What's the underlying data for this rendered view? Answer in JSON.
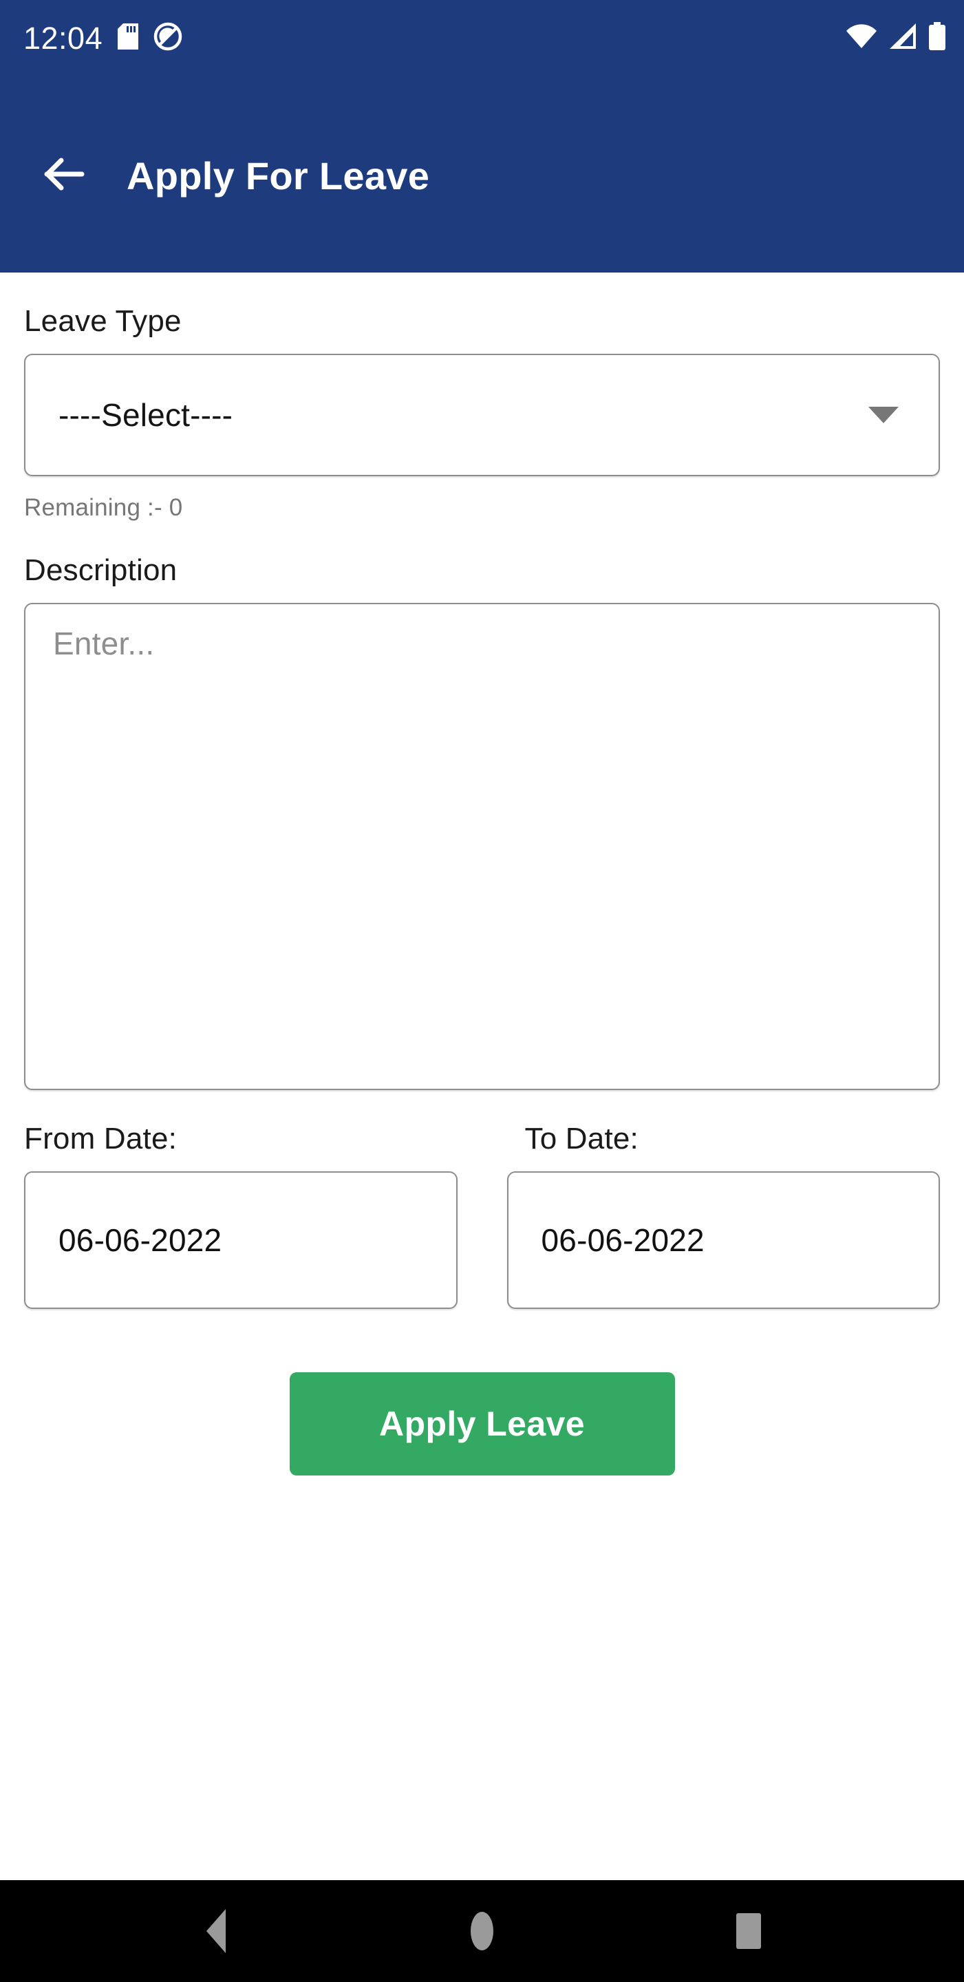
{
  "status_bar": {
    "time": "12:04",
    "left_icons": [
      "sd-card-icon",
      "do-not-disturb-icon"
    ],
    "right_icons": [
      "wifi-icon",
      "cellular-signal-icon",
      "battery-icon"
    ]
  },
  "app_bar": {
    "back_icon": "back-arrow-icon",
    "title": "Apply For Leave",
    "background_color": "#1e3b7d"
  },
  "form": {
    "leave_type": {
      "label": "Leave Type",
      "selected_value": "----Select----",
      "caret_icon": "chevron-down-icon",
      "helper_text": "Remaining :- 0"
    },
    "description": {
      "label": "Description",
      "value": "",
      "placeholder": "Enter..."
    },
    "from_date": {
      "label": "From Date:",
      "value": "06-06-2022"
    },
    "to_date": {
      "label": "To Date:",
      "value": "06-06-2022"
    },
    "submit": {
      "label": "Apply Leave",
      "color": "#33a963"
    }
  },
  "nav_bar": {
    "back_label": "back-triangle-icon",
    "home_label": "home-circle-icon",
    "recents_label": "recents-square-icon",
    "background_color": "#000000"
  }
}
